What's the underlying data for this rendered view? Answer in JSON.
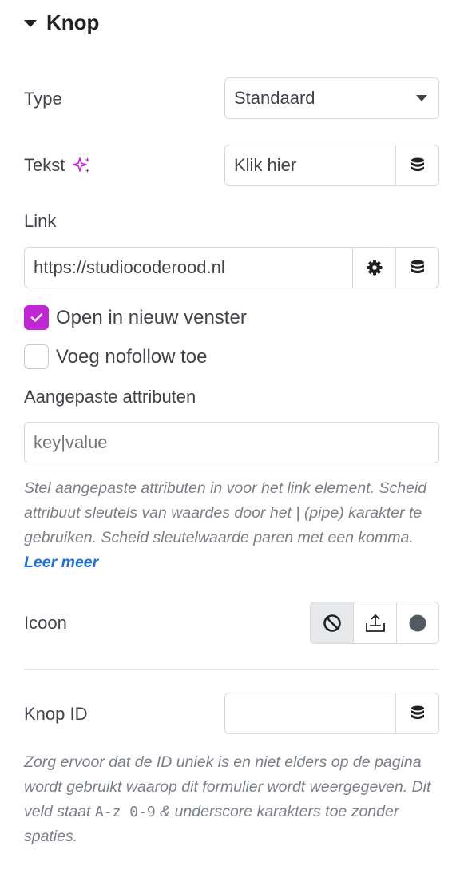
{
  "section": {
    "title": "Knop"
  },
  "type_field": {
    "label": "Type",
    "value": "Standaard"
  },
  "text_field": {
    "label": "Tekst",
    "value": "Klik hier"
  },
  "link": {
    "label": "Link",
    "value": "https://studiocoderood.nl",
    "open_new_window": {
      "label": "Open in nieuw venster",
      "checked": true
    },
    "nofollow": {
      "label": "Voeg nofollow toe",
      "checked": false
    }
  },
  "custom_attributes": {
    "label": "Aangepaste attributen",
    "placeholder": "key|value",
    "help": "Stel aangepaste attributen in voor het link element. Scheid attribuut sleutels van waardes door het | (pipe) karakter te gebruiken. Scheid sleutelwaarde paren met een komma.",
    "help_link": "Leer meer"
  },
  "icon_field": {
    "label": "Icoon",
    "options": [
      {
        "icon": "none-icon",
        "active": true
      },
      {
        "icon": "upload-icon",
        "active": false
      },
      {
        "icon": "circle-icon",
        "active": false
      }
    ]
  },
  "button_id": {
    "label": "Knop ID",
    "value": "",
    "help_before": "Zorg ervoor dat de ID uniek is en niet elders op de pagina wordt gebruikt waarop dit formulier wordt weergegeven. Dit veld staat ",
    "help_code": "A-z 0-9",
    "help_after": " & underscore karakters toe zonder spaties."
  },
  "colors": {
    "accent": "#c026d3",
    "link": "#1d6ee0"
  }
}
